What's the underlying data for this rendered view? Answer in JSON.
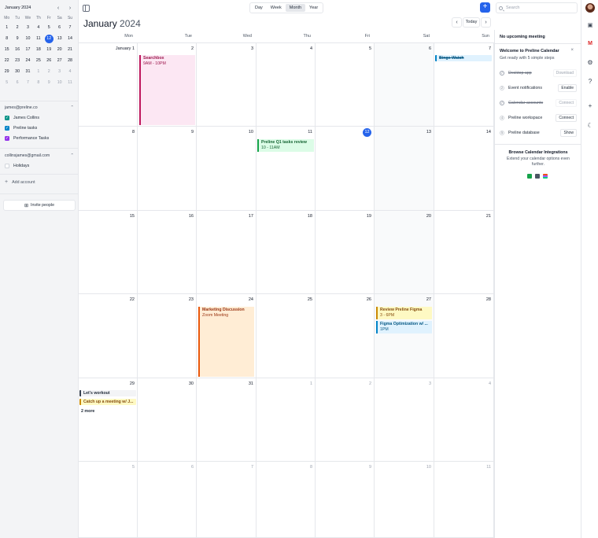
{
  "mini_calendar": {
    "title": "January 2024",
    "prev": "‹",
    "next": "›",
    "weekdays": [
      "Mo",
      "Tu",
      "We",
      "Th",
      "Fr",
      "Sa",
      "Su"
    ],
    "days": [
      {
        "n": "1"
      },
      {
        "n": "2"
      },
      {
        "n": "3"
      },
      {
        "n": "4"
      },
      {
        "n": "5"
      },
      {
        "n": "6"
      },
      {
        "n": "7"
      },
      {
        "n": "8"
      },
      {
        "n": "9"
      },
      {
        "n": "10"
      },
      {
        "n": "11"
      },
      {
        "n": "12",
        "today": true
      },
      {
        "n": "13"
      },
      {
        "n": "14"
      },
      {
        "n": "15"
      },
      {
        "n": "16"
      },
      {
        "n": "17"
      },
      {
        "n": "18"
      },
      {
        "n": "19"
      },
      {
        "n": "20"
      },
      {
        "n": "21"
      },
      {
        "n": "22"
      },
      {
        "n": "23"
      },
      {
        "n": "24"
      },
      {
        "n": "25"
      },
      {
        "n": "26"
      },
      {
        "n": "27"
      },
      {
        "n": "28"
      },
      {
        "n": "29"
      },
      {
        "n": "30"
      },
      {
        "n": "31"
      },
      {
        "n": "1",
        "muted": true
      },
      {
        "n": "2",
        "muted": true
      },
      {
        "n": "3",
        "muted": true
      },
      {
        "n": "4",
        "muted": true
      },
      {
        "n": "5",
        "muted": true
      },
      {
        "n": "6",
        "muted": true
      },
      {
        "n": "7",
        "muted": true
      },
      {
        "n": "8",
        "muted": true
      },
      {
        "n": "9",
        "muted": true
      },
      {
        "n": "10",
        "muted": true
      },
      {
        "n": "11",
        "muted": true
      }
    ]
  },
  "accounts": [
    {
      "email": "james@preline.co",
      "calendars": [
        {
          "label": "James Collins",
          "color": "#0d9488",
          "checked": true
        },
        {
          "label": "Preline tasks",
          "color": "#0284c7",
          "checked": true
        },
        {
          "label": "Performance Tasks",
          "color": "#9333ea",
          "checked": true
        }
      ]
    },
    {
      "email": "collinsjames@gmail.com",
      "calendars": [
        {
          "label": "Holidays",
          "color": "#ffffff",
          "checked": false
        }
      ]
    }
  ],
  "sidebar": {
    "add_account": "Add account",
    "invite_people": "Invite people"
  },
  "toolbar": {
    "views": [
      "Day",
      "Week",
      "Month",
      "Year"
    ],
    "active_view": "Month",
    "create": "+",
    "search_placeholder": "Search",
    "month": "January",
    "year": "2024",
    "prev": "‹",
    "today": "Today",
    "next": "›"
  },
  "calendar": {
    "weekdays": [
      "Mon",
      "Tue",
      "Wed",
      "Thu",
      "Fri",
      "Sat",
      "Sun"
    ],
    "weeks": [
      [
        "January 1",
        "2",
        "3",
        "4",
        "5",
        "6",
        "7"
      ],
      [
        "8",
        "9",
        "10",
        "11",
        "12",
        "13",
        "14"
      ],
      [
        "15",
        "16",
        "17",
        "18",
        "19",
        "20",
        "21"
      ],
      [
        "22",
        "23",
        "24",
        "25",
        "26",
        "27",
        "28"
      ],
      [
        "29",
        "30",
        "31",
        "1",
        "2",
        "3",
        "4"
      ],
      [
        "5",
        "6",
        "7",
        "8",
        "9",
        "10",
        "11"
      ]
    ],
    "today": {
      "week": 1,
      "day": 4
    },
    "events": {
      "searchbox": {
        "title": "Searchbox",
        "time": "9AM - 10PM",
        "bg": "#fce7f3",
        "border": "#be185d",
        "color": "#9d174d"
      },
      "binge": {
        "title": "Binge-Watch",
        "bg": "#e0f2fe",
        "border": "#0284c7",
        "color": "#075985"
      },
      "q1": {
        "title": "Preline Q1 tasks review",
        "time": "10 - 11AM",
        "bg": "#dcfce7",
        "border": "#16a34a",
        "color": "#166534"
      },
      "marketing": {
        "title": "Marketing Discussion",
        "time": "Zoom Meeting",
        "bg": "#ffedd5",
        "border": "#ea580c",
        "color": "#9a3412"
      },
      "figma": {
        "title": "Review Preline Figma",
        "time": "3 - 6PM",
        "bg": "#fef9c3",
        "border": "#ca8a04",
        "color": "#854d0e"
      },
      "figma_opt": {
        "title": "Figma Optimization w/ ...",
        "time": "1PM",
        "bg": "#e0f2fe",
        "border": "#0284c7",
        "color": "#075985"
      },
      "workout": {
        "title": "Let's workout",
        "bg": "#f3f4f6",
        "border": "#374151",
        "color": "#1f2937"
      },
      "catchup": {
        "title": "Catch up a meeting w/ J...",
        "bg": "#fef9c3",
        "border": "#ca8a04",
        "color": "#854d0e"
      },
      "more": "2 more"
    }
  },
  "panel": {
    "no_meeting": "No upcoming meeting",
    "welcome_title": "Welcome to Preline Calendar",
    "welcome_sub": "Get ready with 5 simple steps",
    "close": "×",
    "steps": [
      {
        "marker": "✓",
        "label": "Desktop app",
        "action": "Download",
        "done": true
      },
      {
        "marker": "2",
        "label": "Event notifications",
        "action": "Enable",
        "done": false
      },
      {
        "marker": "✓",
        "label": "Calendar accounts",
        "action": "Connect",
        "done": true
      },
      {
        "marker": "4",
        "label": "Preline workspace",
        "action": "Connect",
        "done": false
      },
      {
        "marker": "5",
        "label": "Preline database",
        "action": "Show",
        "done": false
      }
    ],
    "browse_title": "Browse Calendar Integrations",
    "browse_sub": "Extend your calendar options even further."
  },
  "rail_icons": [
    "calendar-icon",
    "gmail-icon",
    "gear-icon",
    "help-icon",
    "plus-icon",
    "moon-icon"
  ]
}
